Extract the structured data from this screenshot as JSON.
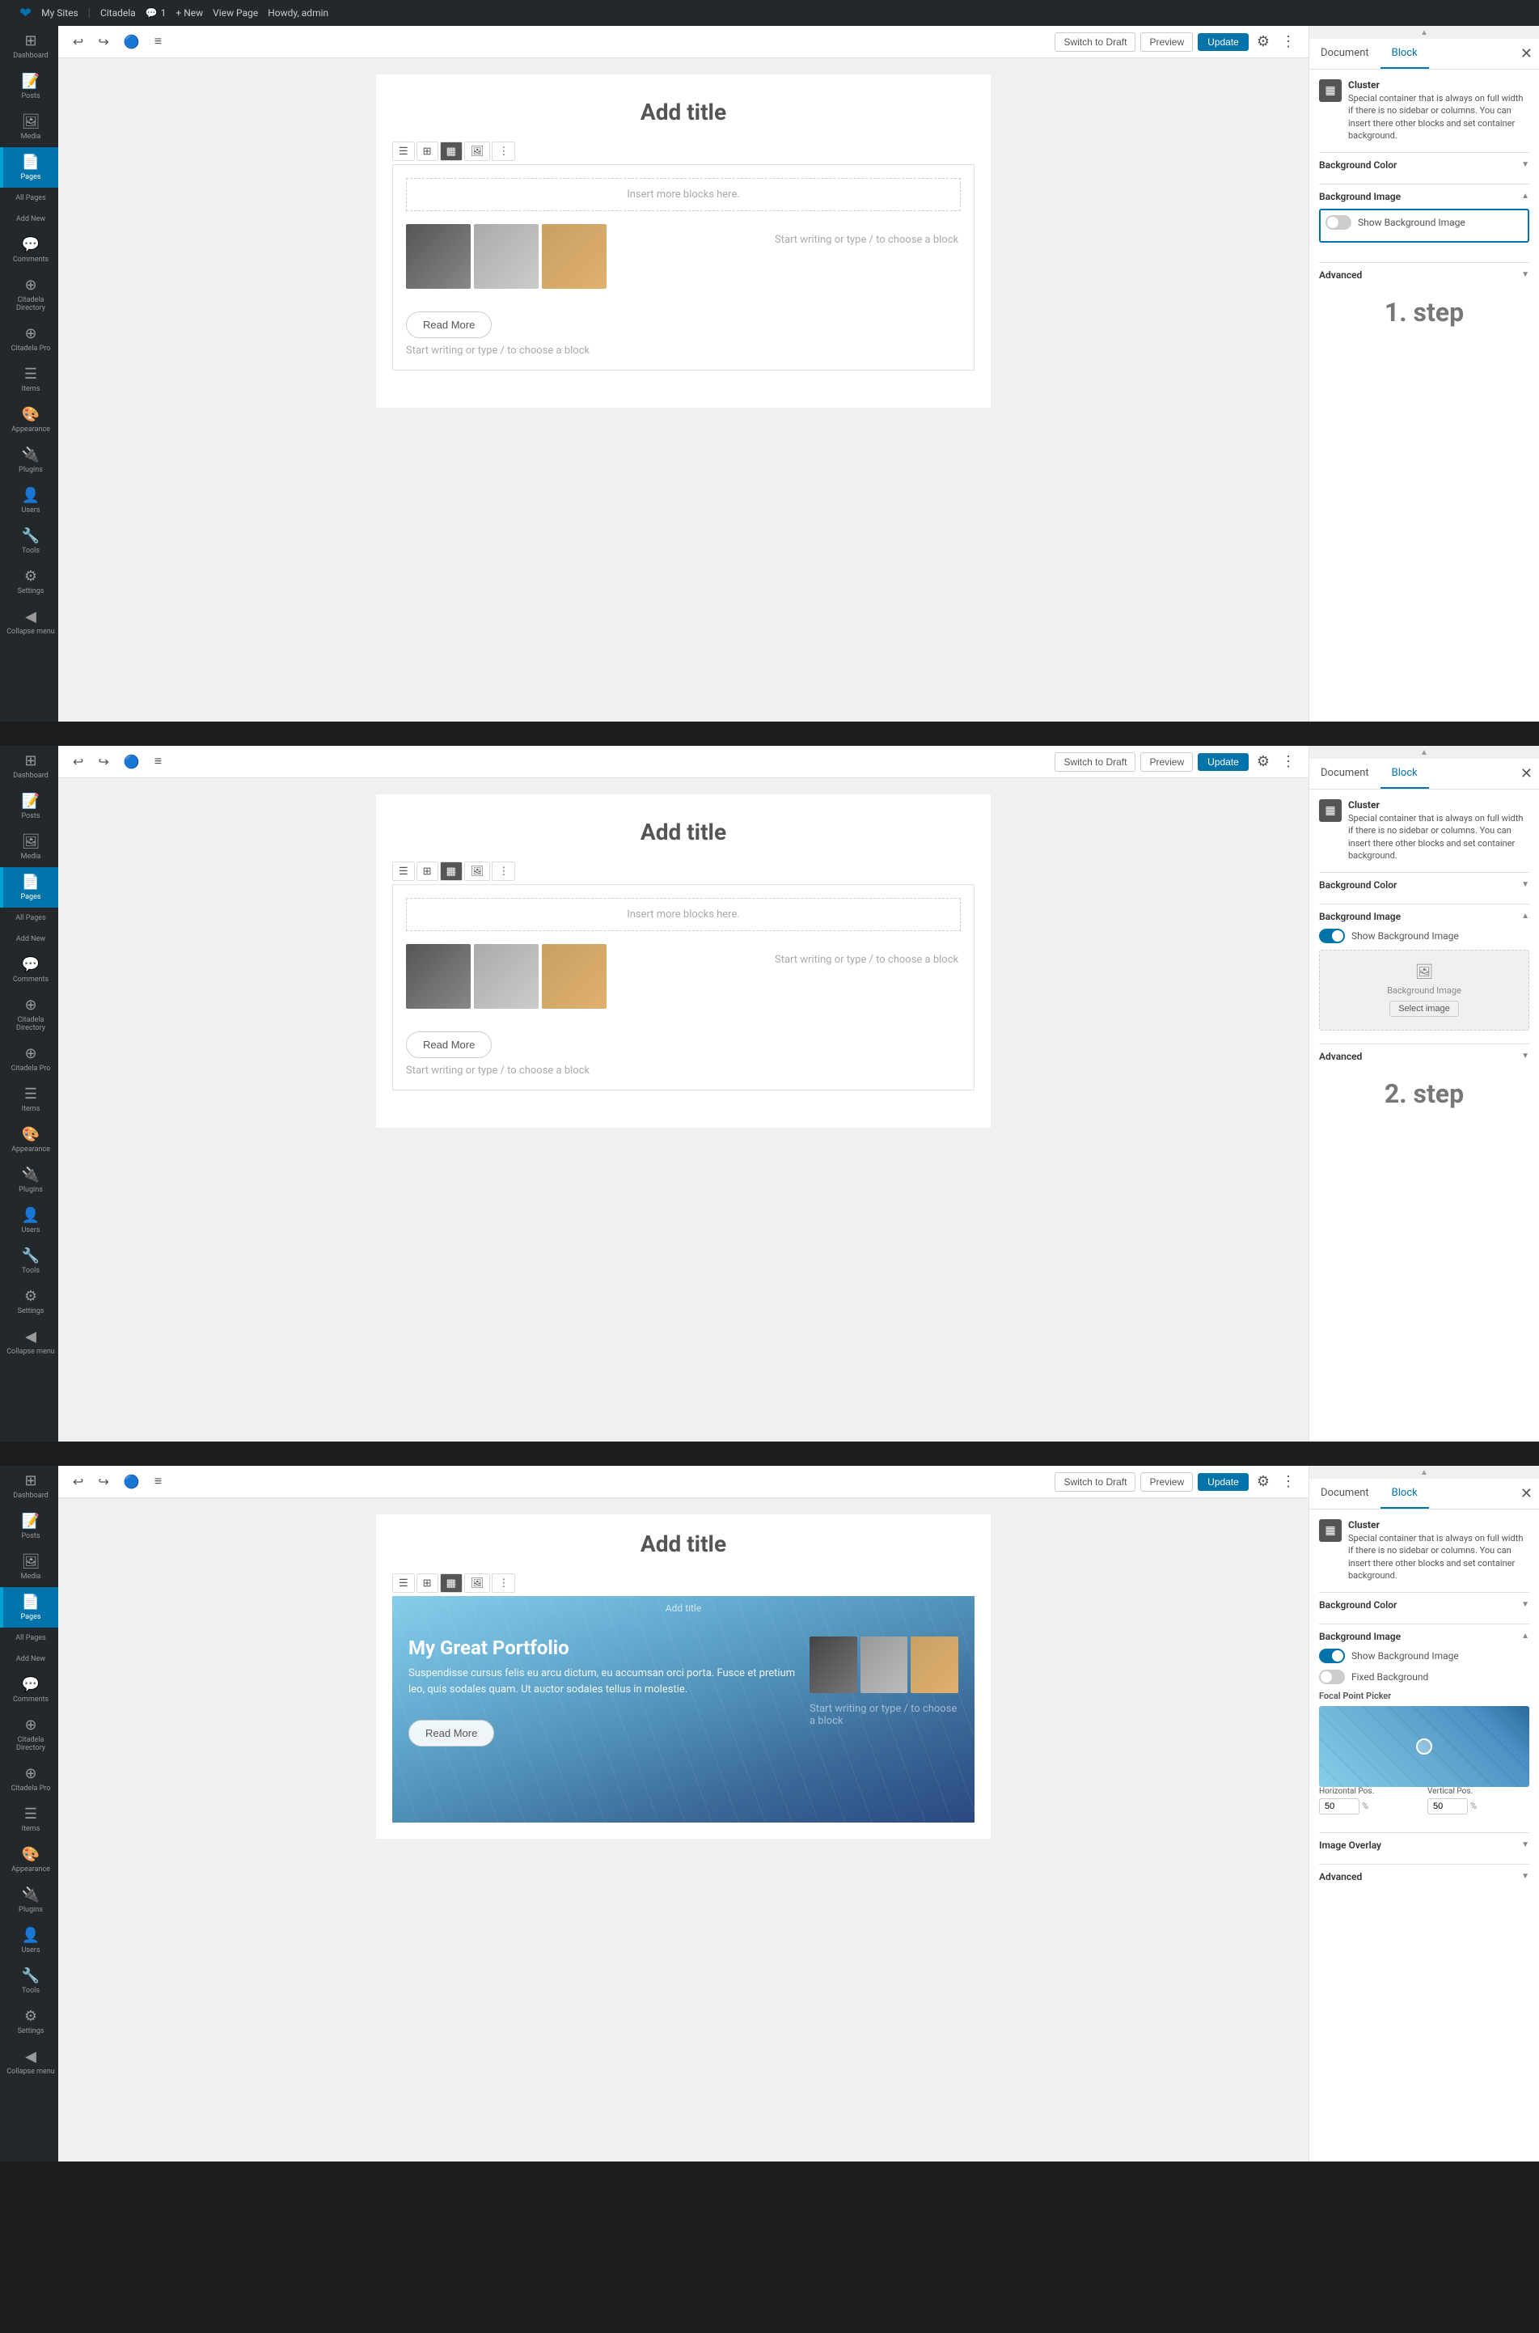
{
  "adminBar": {
    "wpLogo": "❤",
    "mySites": "My Sites",
    "siteLink": "Citadela",
    "commentCount": "1",
    "newLabel": "+ New",
    "viewPage": "View Page",
    "howdy": "Howdy, admin"
  },
  "sidebar": {
    "items": [
      {
        "id": "dashboard",
        "icon": "⊞",
        "label": "Dashboard"
      },
      {
        "id": "posts",
        "icon": "📝",
        "label": "Posts"
      },
      {
        "id": "media",
        "icon": "🖼",
        "label": "Media"
      },
      {
        "id": "pages",
        "icon": "📄",
        "label": "Pages",
        "active": true
      },
      {
        "id": "comments",
        "icon": "💬",
        "label": "Comments"
      },
      {
        "id": "citadela-directory",
        "icon": "⊕",
        "label": "Citadela Directory"
      },
      {
        "id": "citadela-pro",
        "icon": "⊕",
        "label": "Citadela Pro"
      },
      {
        "id": "items",
        "icon": "☰",
        "label": "Items"
      },
      {
        "id": "appearance",
        "icon": "🎨",
        "label": "Appearance"
      },
      {
        "id": "plugins",
        "icon": "🔌",
        "label": "Plugins"
      },
      {
        "id": "users",
        "icon": "👤",
        "label": "Users"
      },
      {
        "id": "tools",
        "icon": "🔧",
        "label": "Tools"
      },
      {
        "id": "settings",
        "icon": "⚙",
        "label": "Settings"
      },
      {
        "id": "collapse",
        "icon": "◀",
        "label": "Collapse menu"
      }
    ]
  },
  "pages": {
    "label": "Pages",
    "allPages": "All Pages",
    "addNew": "Add New"
  },
  "panels": [
    {
      "id": "panel1",
      "step": "1. step",
      "toolbar": {
        "switchToDraft": "Switch to Draft",
        "preview": "Preview",
        "update": "Update"
      },
      "tabs": {
        "document": "Document",
        "block": "Block"
      },
      "pageTitle": "Add title",
      "blockLabel": "Cluster",
      "blockDesc": "Special container that is always on full width if there is no sidebar or columns. You can insert there other blocks and set container background.",
      "insertBlocks": "Insert more blocks here.",
      "bgColorLabel": "Background Color",
      "bgImageLabel": "Background Image",
      "showBgImage": "Show Background Image",
      "toggleOn": false,
      "advancedLabel": "Advanced",
      "startWriting1": "Start writing or type / to choose a block",
      "startWriting2": "Start writing or type / to choose a block",
      "readMore": "Read More",
      "highlighted": true
    },
    {
      "id": "panel2",
      "step": "2. step",
      "toolbar": {
        "switchToDraft": "Switch to Draft",
        "preview": "Preview",
        "update": "Update"
      },
      "tabs": {
        "document": "Document",
        "block": "Block"
      },
      "pageTitle": "Add title",
      "blockLabel": "Cluster",
      "blockDesc": "Special container that is always on full width if there is no sidebar or columns. You can insert there other blocks and set container background.",
      "insertBlocks": "Insert more blocks here.",
      "bgColorLabel": "Background Color",
      "bgImageLabel": "Background Image",
      "showBgImage": "Show Background Image",
      "toggleOn": true,
      "bgImagePlaceholder": "Background Image",
      "selectImage": "Select image",
      "advancedLabel": "Advanced",
      "startWriting1": "Start writing or type / to choose a block",
      "startWriting2": "Start writing or type / to choose a block",
      "readMore": "Read More"
    },
    {
      "id": "panel3",
      "step": "",
      "toolbar": {
        "switchToDraft": "Switch to Draft",
        "preview": "Preview",
        "update": "Update"
      },
      "tabs": {
        "document": "Document",
        "block": "Block"
      },
      "pageTitle": "Add title",
      "blockLabel": "Cluster",
      "blockDesc": "Special container that is always on full width if there is no sidebar or columns. You can insert there other blocks and set container background.",
      "bgColorLabel": "Background Color",
      "bgImageLabel": "Background Image",
      "showBgImage": "Show Background Image",
      "fixedBackground": "Fixed Background",
      "toggleBgOn": true,
      "toggleFixedOn": false,
      "focalPointPicker": "Focal Point Picker",
      "horizontalPos": "Horizontal Pos.",
      "verticalPos": "Vertical Pos.",
      "hValue": "50",
      "vValue": "50",
      "percent": "%",
      "imageOverlay": "Image Overlay",
      "advancedLabel": "Advanced",
      "portfolioTitle": "My Great Portfolio",
      "portfolioDesc": "Suspendisse cursus felis eu arcu dictum, eu accumsan orci porta. Fusce et pretium leo, quis sodales quam. Ut auctor sodales tellus in molestie.",
      "readMore": "Read More",
      "startWriting": "Start writing or type / to choose a block"
    }
  ]
}
